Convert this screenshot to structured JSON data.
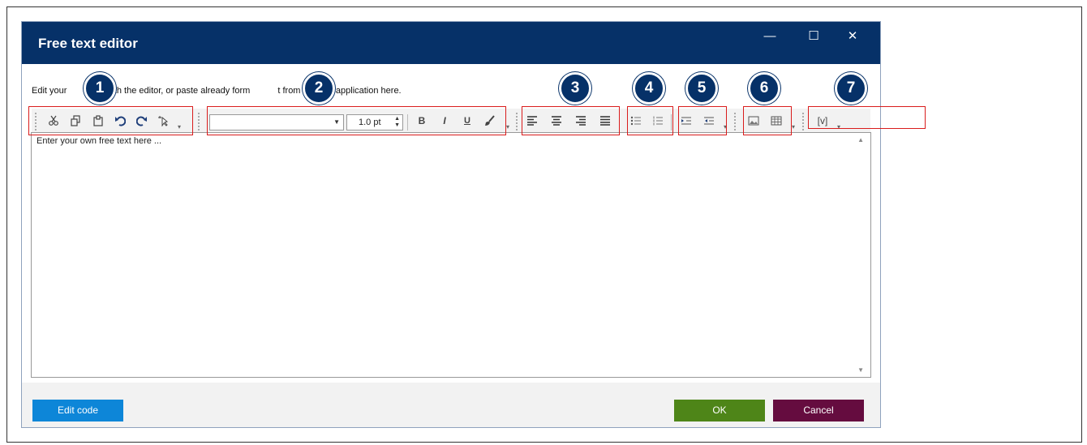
{
  "dialog": {
    "title": "Free text editor",
    "controls": {
      "minimize": "—",
      "maximize": "☐",
      "close": "✕"
    }
  },
  "intro": {
    "part1": "Edit your",
    "part2": "with the editor, or paste already form",
    "part3": "t from another application here."
  },
  "toolbar": {
    "edit_icons": [
      "cut-icon",
      "copy-icon",
      "paste-icon",
      "undo-icon",
      "redo-icon",
      "select-all-icon"
    ],
    "font_family": "",
    "font_size": "1.0 pt",
    "bold": "B",
    "italic": "I",
    "underline": "U",
    "align_icons": [
      "align-left-icon",
      "align-center-icon",
      "align-right-icon",
      "justify-icon"
    ],
    "list_icons": [
      "bullet-list-icon",
      "numbered-list-icon"
    ],
    "indent_icons": [
      "indent-icon",
      "outdent-icon"
    ],
    "insert_icons": [
      "image-icon",
      "table-icon"
    ],
    "variable_label": "[v]"
  },
  "editor": {
    "placeholder": "Enter your own free text here ..."
  },
  "footer": {
    "edit_code": "Edit code",
    "ok": "OK",
    "cancel": "Cancel"
  },
  "markers": [
    "1",
    "2",
    "3",
    "4",
    "5",
    "6",
    "7"
  ],
  "colors": {
    "titlebar": "#063168",
    "edit_code_button": "#0d86d8",
    "ok_button": "#4e8518",
    "cancel_button": "#650c3f",
    "highlight_box": "#d91c1c",
    "marker": "#063168"
  }
}
